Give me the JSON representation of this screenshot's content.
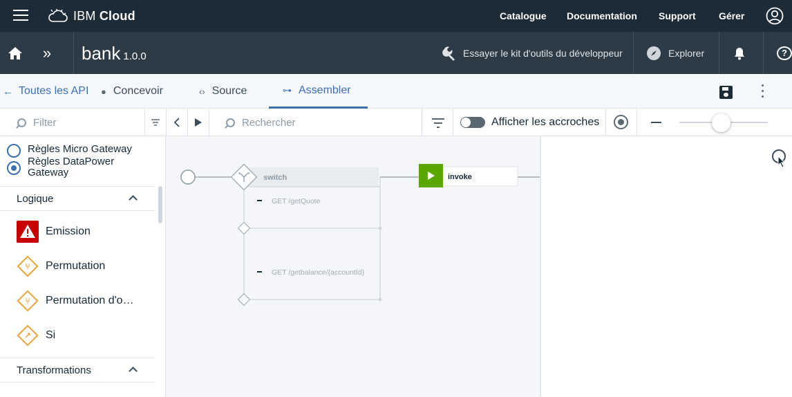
{
  "topbar": {
    "brand_prefix": "IBM",
    "brand_name": "Cloud",
    "nav": [
      "Catalogue",
      "Documentation",
      "Support",
      "Gérer"
    ]
  },
  "appbar": {
    "title": "bank",
    "version": "1.0.0",
    "dev_kit_label": "Essayer le kit d'outils du développeur",
    "explore_label": "Explorer"
  },
  "tabs": {
    "back_label": "Toutes les API",
    "items": [
      {
        "label": "Concevoir",
        "icon": "palette-icon"
      },
      {
        "label": "Source",
        "icon": "code-icon"
      },
      {
        "label": "Assembler",
        "icon": "assemble-icon",
        "active": true
      }
    ]
  },
  "toolbar": {
    "filter_placeholder": "Filter",
    "search_placeholder": "Rechercher",
    "toggle_label": "Afficher les accroches",
    "toggle_on": false,
    "zoom_level": 0.47
  },
  "palette": {
    "gateways": [
      {
        "label": "Règles Micro Gateway",
        "checked": false
      },
      {
        "label": "Règles DataPower Gateway",
        "checked": true
      }
    ],
    "sections": [
      {
        "title": "Logique",
        "items": [
          {
            "label": "Emission",
            "icon": "warning-icon"
          },
          {
            "label": "Permutation",
            "icon": "switch-icon"
          },
          {
            "label": "Permutation d'o…",
            "icon": "operation-switch-icon"
          },
          {
            "label": "Si",
            "icon": "if-icon"
          }
        ]
      },
      {
        "title": "Transformations",
        "items": []
      }
    ]
  },
  "assembly": {
    "switch_label": "switch",
    "cases": [
      "GET /getQuote",
      "GET /getbalance/{accountId}"
    ],
    "invoke_label": "invoke",
    "colors": {
      "invoke": "#5aa700",
      "diamond_palette": "#f0a536",
      "emission": "#c90000",
      "accent": "#3d70b2"
    }
  }
}
